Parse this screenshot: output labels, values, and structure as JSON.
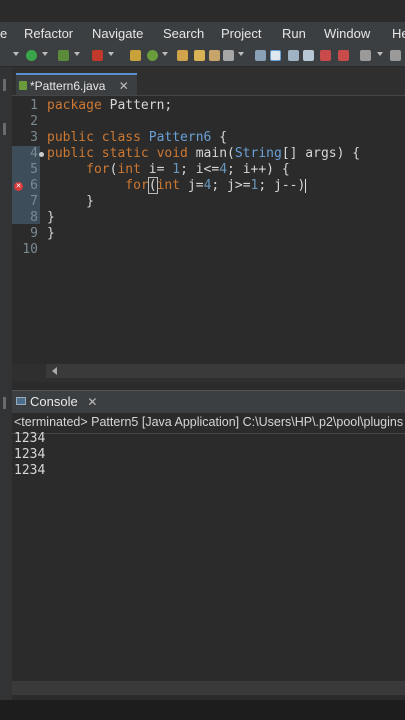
{
  "menubar": {
    "items": [
      "e",
      "Refactor",
      "Navigate",
      "Search",
      "Project",
      "Run",
      "Window",
      "He"
    ]
  },
  "editor": {
    "tab_label": "*Pattern6.java",
    "tab_close": "✕",
    "line_numbers": [
      "1",
      "2",
      "3",
      "4",
      "5",
      "6",
      "7",
      "8",
      "9",
      "10"
    ],
    "code": {
      "l1_kw": "package",
      "l1_rest": " Pattern;",
      "l3_kw": "public class",
      "l3_cls": " Pattern6",
      "l3_rest": " {",
      "l4_kw": "public static void",
      "l4_mid": " main(",
      "l4_type": "String",
      "l4_rest": "[] args) {",
      "l5_indent": "     ",
      "l5_kw": "for",
      "l5_p1": "(",
      "l5_kw2": "int",
      "l5_p2": " i= ",
      "l5_n1": "1",
      "l5_p3": "; i<=",
      "l5_n2": "4",
      "l5_p4": "; i++) {",
      "l6_indent": "          ",
      "l6_kw": "for",
      "l6_bracket": "(",
      "l6_kw2": "int",
      "l6_p1": " j=",
      "l6_n1": "4",
      "l6_p2": "; j>=",
      "l6_n2": "1",
      "l6_p3": "; j--)",
      "l7": "     }",
      "l8": "}",
      "l9": "}"
    }
  },
  "console": {
    "tab_label": "Console",
    "tab_close": "✕",
    "description": "<terminated> Pattern5 [Java Application] C:\\Users\\HP\\.p2\\pool\\plugins",
    "output": [
      "1234",
      "1234",
      "1234"
    ]
  },
  "colors": {
    "keyword": "#cc7832",
    "class_name": "#6aa0d6",
    "number": "#6897bb",
    "error": "#d83b3b"
  }
}
